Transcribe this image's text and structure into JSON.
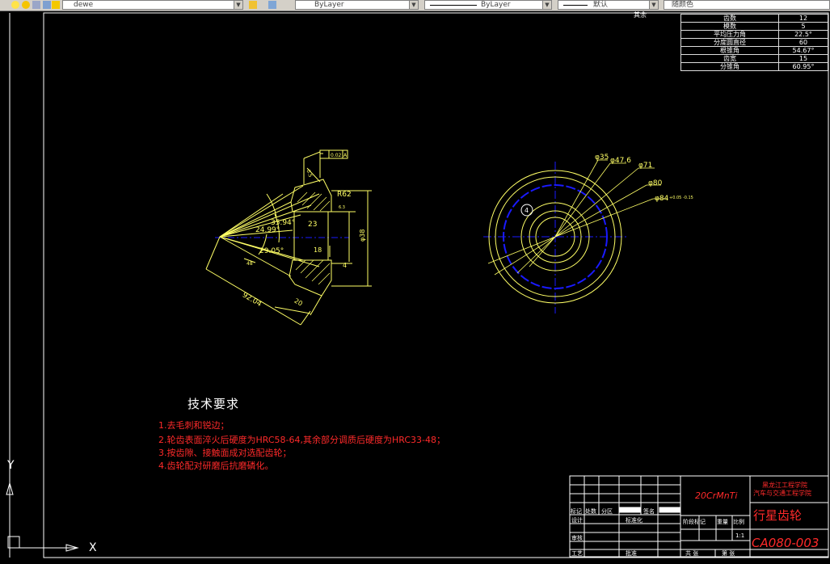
{
  "toolbar": {
    "layer_name": "dewe",
    "color_control": "ByLayer",
    "linetype_control": "ByLayer",
    "lineweight_control": "默认",
    "plotstyle_control": "随颜色"
  },
  "drawing": {
    "corner_label": "其余",
    "params_table": [
      {
        "label": "齿数",
        "value": "12"
      },
      {
        "label": "模数",
        "value": "5"
      },
      {
        "label": "平均压力角",
        "value": "22.5°"
      },
      {
        "label": "分度圆直径",
        "value": "60"
      },
      {
        "label": "根锥角",
        "value": "54.67°"
      },
      {
        "label": "齿宽",
        "value": "15"
      },
      {
        "label": "分锥角",
        "value": "60.95°"
      }
    ],
    "dims_left": {
      "tolerance": "0.02",
      "datum": "A",
      "radius": "R62",
      "angle1": "35.94°",
      "angle2": "24.99°",
      "angle3": "29.05°",
      "dim_23": "23",
      "dim_18": "18",
      "dim_4": "4",
      "dim_diam": "φ38",
      "dim_9204": "92.04",
      "dim_20": "20",
      "dim_48": "48",
      "finish": "6.3",
      "tol_small": "0.5"
    },
    "dims_right": {
      "d35": "φ35",
      "d476": "φ47.6",
      "d71": "φ71",
      "d80": "φ80",
      "d84": "φ84",
      "d84_tol": "+0.05 -0.15",
      "label_a": "4"
    },
    "tech_title": "技术要求",
    "tech_items": [
      "1.去毛刺和锐边；",
      "2.轮齿表面淬火后硬度为HRC58-64,其余部分调质后硬度为HRC33-48；",
      "3.按齿隙、接触面成对选配齿轮；",
      "4.齿轮配对研磨后抗磨磷化。"
    ],
    "ucs": {
      "x": "X",
      "y": "Y"
    }
  },
  "title_block": {
    "material": "20CrMnTi",
    "school_line1": "黑龙江工程学院",
    "school_line2": "汽车与交通工程学院",
    "part_name": "行星齿轮",
    "drawing_no": "CA080-003",
    "labels": {
      "mark": "标记",
      "count": "处数",
      "zone": "分区",
      "sign": "签名",
      "design": "设计",
      "standard": "标准化",
      "stage": "阶段标记",
      "weight": "重量",
      "scale": "比例",
      "scale_value": "1:1",
      "review": "审核",
      "process": "工艺",
      "approve": "批准",
      "total_sheets": "共 张",
      "sheet_no": "第 张"
    }
  },
  "colors": {
    "part": "#ffff66",
    "center": "#1a1aff",
    "text_red": "#ff2a2a",
    "frame": "#ffffff",
    "dim": "#ffff66"
  }
}
